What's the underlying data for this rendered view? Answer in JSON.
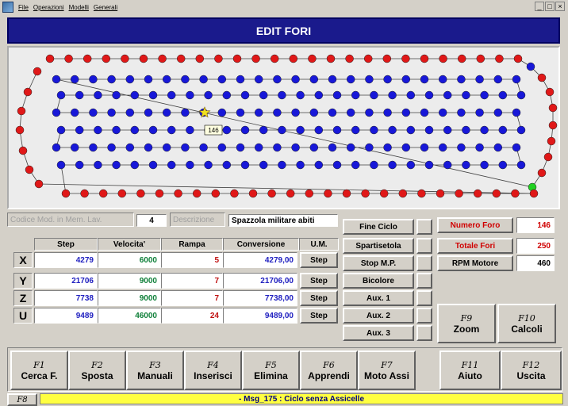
{
  "window": {
    "menu": [
      "File",
      "Operazioni",
      "Modelli",
      "Generali"
    ],
    "controls": [
      "_",
      "□",
      "×"
    ]
  },
  "header": {
    "title": "EDIT FORI"
  },
  "canvas": {
    "tooltip": "146",
    "colors": {
      "outer": "#e01818",
      "inner": "#1818d8",
      "selected": "#f0e020",
      "end": "#20d020",
      "line": "#404040"
    }
  },
  "info": {
    "codice_label": "Codice Mod. in Mem. Lav.",
    "codice_value": "4",
    "descrizione_label": "Descrizione",
    "descrizione_value": "Spazzola militare abiti"
  },
  "table": {
    "headers": [
      "Step",
      "Velocita'",
      "Rampa",
      "Conversione",
      "U.M."
    ],
    "rows": [
      {
        "axis": "X",
        "step": "4279",
        "vel": "6000",
        "rampa": "5",
        "conv": "4279,00",
        "um": "Step"
      },
      {
        "axis": "Y",
        "step": "21706",
        "vel": "9000",
        "rampa": "7",
        "conv": "21706,00",
        "um": "Step"
      },
      {
        "axis": "Z",
        "step": "7738",
        "vel": "9000",
        "rampa": "7",
        "conv": "7738,00",
        "um": "Step"
      },
      {
        "axis": "U",
        "step": "9489",
        "vel": "46000",
        "rampa": "24",
        "conv": "9489,00",
        "um": "Step"
      }
    ]
  },
  "side_buttons": [
    "Fine Ciclo",
    "Spartisetola",
    "Stop M.P.",
    "Bicolore",
    "Aux. 1",
    "Aux. 2",
    "Aux. 3"
  ],
  "stats": {
    "numero_foro_label": "Numero Foro",
    "numero_foro_value": "146",
    "totale_fori_label": "Totale Fori",
    "totale_fori_value": "250",
    "rpm_label": "RPM Motore",
    "rpm_value": "460"
  },
  "right_keys": [
    {
      "fn": "F9",
      "label": "Zoom"
    },
    {
      "fn": "F10",
      "label": "Calcoli"
    }
  ],
  "fkeys": [
    {
      "fn": "F1",
      "label": "Cerca F."
    },
    {
      "fn": "F2",
      "label": "Sposta"
    },
    {
      "fn": "F3",
      "label": "Manuali"
    },
    {
      "fn": "F4",
      "label": "Inserisci"
    },
    {
      "fn": "F5",
      "label": "Elimina"
    },
    {
      "fn": "F6",
      "label": "Apprendi"
    },
    {
      "fn": "F7",
      "label": "Moto Assi"
    },
    {
      "fn": "F11",
      "label": "Aiuto"
    },
    {
      "fn": "F12",
      "label": "Uscita"
    }
  ],
  "f8": "F8",
  "status_message": "- Msg_175 : Ciclo senza Assicelle"
}
